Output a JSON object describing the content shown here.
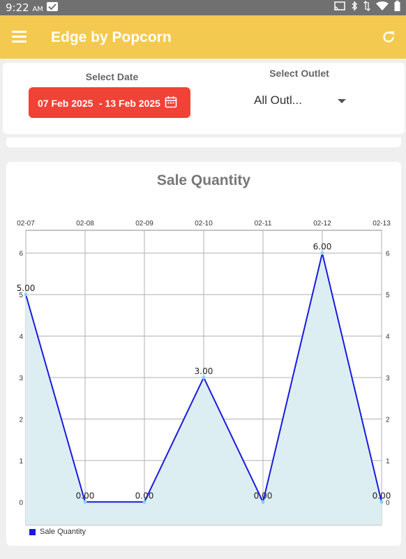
{
  "status_bar": {
    "time": "9:22",
    "ampm": "AM",
    "icons": [
      "check-icon",
      "cast-icon",
      "bluetooth-icon",
      "data-arrows-icon",
      "wifi-icon",
      "battery-icon"
    ]
  },
  "app_bar": {
    "title": "Edge by Popcorn",
    "background": "#f4c94f",
    "icons": [
      "menu-icon",
      "refresh-icon"
    ]
  },
  "filters": {
    "date_label": "Select Date",
    "date_from": "07 Feb 2025",
    "date_to": "- 13 Feb 2025",
    "date_button_color": "#f04237",
    "outlet_label": "Select Outlet",
    "outlet_value": "All Outl..."
  },
  "chart_data": {
    "type": "area",
    "title": "Sale Quantity",
    "categories": [
      "02-07",
      "02-08",
      "02-09",
      "02-10",
      "02-11",
      "02-12",
      "02-13"
    ],
    "series": [
      {
        "name": "Sale Quantity",
        "values": [
          5,
          0,
          0,
          3,
          0,
          6,
          0
        ],
        "color": "#1a1add",
        "fill": "#ddeef3"
      }
    ],
    "data_labels": [
      "5.00",
      "0.00",
      "0.00",
      "3.00",
      "0.00",
      "6.00",
      "0.00"
    ],
    "y_ticks": [
      "0",
      "1",
      "2",
      "3",
      "4",
      "5",
      "6"
    ],
    "ylim": [
      -0.55,
      6.55
    ],
    "grid": true,
    "x_axis_position": "top",
    "y_axis": "both sides",
    "legend": "bottom-left"
  }
}
